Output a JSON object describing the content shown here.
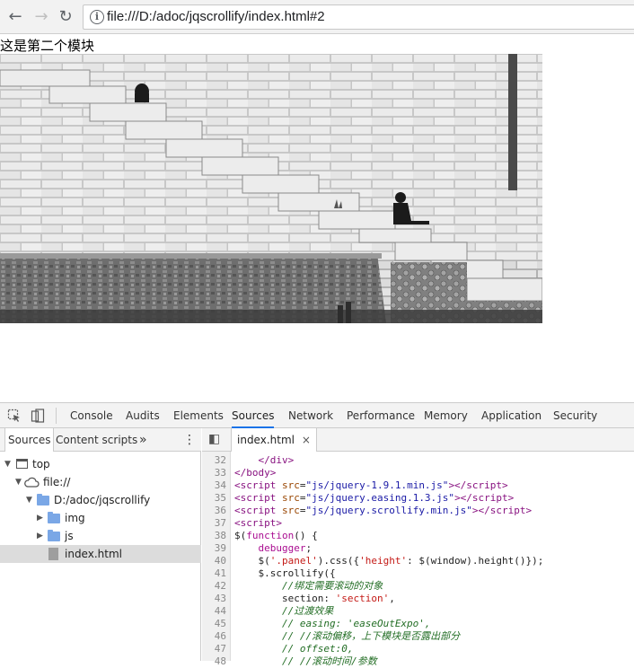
{
  "browser": {
    "url": "file:///D:/adoc/jqscrollify/index.html#2",
    "back_glyph": "←",
    "forward_glyph": "→",
    "reload_glyph": "↻",
    "info_glyph": "i"
  },
  "page": {
    "heading": "这是第二个模块"
  },
  "devtools": {
    "tabs": [
      "Console",
      "Audits",
      "Elements",
      "Sources",
      "Network",
      "Performance",
      "Memory",
      "Application",
      "Security"
    ],
    "active_tab": "Sources",
    "navigator": {
      "tabs": [
        "Sources",
        "Content scripts"
      ],
      "more_glyph": "»",
      "menu_glyph": "⋮",
      "tree": {
        "top": "top",
        "origin": "file://",
        "folder": "D:/adoc/jqscrollify",
        "img": "img",
        "js": "js",
        "file": "index.html"
      }
    },
    "editor": {
      "tab_label": "index.html",
      "close_glyph": "×",
      "toggle_glyph": "◧",
      "lines": [
        {
          "n": "32",
          "html": "    <span class=\"tag\">&lt;/div&gt;</span>"
        },
        {
          "n": "33",
          "html": "<span class=\"tag\">&lt;/body&gt;</span>"
        },
        {
          "n": "34",
          "html": "<span class=\"tag\">&lt;script</span> <span class=\"attr\">src</span>=<span class=\"str\">\"js/jquery-1.9.1.min.js\"</span><span class=\"tag\">&gt;&lt;/script&gt;</span>"
        },
        {
          "n": "35",
          "html": "<span class=\"tag\">&lt;script</span> <span class=\"attr\">src</span>=<span class=\"str\">\"js/jquery.easing.1.3.js\"</span><span class=\"tag\">&gt;&lt;/script&gt;</span>"
        },
        {
          "n": "36",
          "html": "<span class=\"tag\">&lt;script</span> <span class=\"attr\">src</span>=<span class=\"str\">\"js/jquery.scrollify.min.js\"</span><span class=\"tag\">&gt;&lt;/script&gt;</span>"
        },
        {
          "n": "37",
          "html": "<span class=\"tag\">&lt;script&gt;</span>"
        },
        {
          "n": "38",
          "html": "$(<span class=\"kw\">function</span>() {"
        },
        {
          "n": "39",
          "html": "    <span class=\"kw\">debugger</span>;"
        },
        {
          "n": "40",
          "html": "    $(<span class=\"strr\">'.panel'</span>).css({<span class=\"strr\">'height'</span>: $(window).height()});"
        },
        {
          "n": "41",
          "html": "    $.scrollify({"
        },
        {
          "n": "42",
          "html": "        <span class=\"cmt\">//绑定需要滚动的对象</span>"
        },
        {
          "n": "43",
          "html": "        section: <span class=\"strr\">'section'</span>,"
        },
        {
          "n": "44",
          "html": "        <span class=\"cmt\">//过渡效果</span>"
        },
        {
          "n": "45",
          "html": "        <span class=\"cmt\">// easing: 'easeOutExpo',</span>"
        },
        {
          "n": "46",
          "html": "        <span class=\"cmt\">// //滚动偏移，上下模块是否露出部分</span>"
        },
        {
          "n": "47",
          "html": "        <span class=\"cmt\">// offset:0,</span>"
        },
        {
          "n": "48",
          "html": "        <span class=\"cmt\">// //滚动时间/参数</span>"
        }
      ]
    }
  },
  "colors": {
    "accent": "#1a73e8",
    "folder": "#7aa7e6"
  }
}
